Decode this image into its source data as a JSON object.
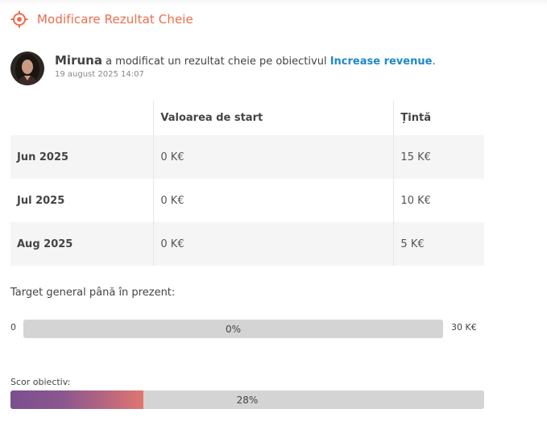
{
  "header": {
    "title": "Modificare Rezultat Cheie",
    "icon": "target-icon",
    "accent_color": "#ef6c4a"
  },
  "activity": {
    "user_name": "Miruna",
    "action_text": " a modificat un rezultat cheie pe obiectivul ",
    "objective_link": "Increase revenue",
    "trailing": ".",
    "timestamp": "19 august 2025 14:07",
    "link_color": "#1e88c8"
  },
  "table": {
    "headers": [
      "",
      "Valoarea de start",
      "Țintă"
    ],
    "rows": [
      {
        "month": "Jun 2025",
        "start": "0 K€",
        "target": "15 K€"
      },
      {
        "month": "Jul 2025",
        "start": "0 K€",
        "target": "10 K€"
      },
      {
        "month": "Aug 2025",
        "start": "0 K€",
        "target": "5 K€"
      }
    ]
  },
  "target_progress": {
    "label": "Target general până în prezent:",
    "min": "0",
    "max": "30 K€",
    "percent_text": "0%",
    "fraction": 0
  },
  "score": {
    "label": "Scor obiectiv:",
    "percent_text": "28%",
    "fraction": 0.28
  }
}
